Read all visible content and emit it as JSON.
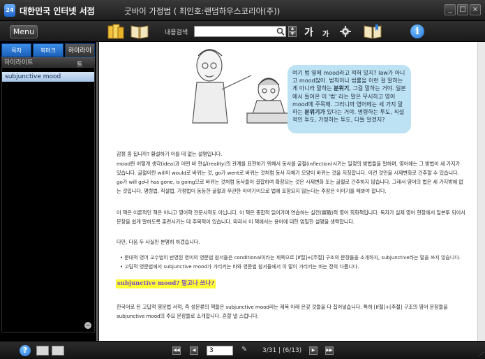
{
  "window": {
    "app_logo": "24",
    "app_name": "대한민국 인터넷 서점",
    "book_title": "굿바이 가정법 ( 최인호:랜덤하우스코리아(주))",
    "controls": [
      "_",
      "□",
      "×"
    ]
  },
  "toolbar": {
    "menu_label": "Menu",
    "search_label": "내용검색",
    "search_value": "",
    "font_larger": "가",
    "font_smaller": "가",
    "icons": [
      "books-icon",
      "open-book-icon",
      "settings-icon",
      "bookmark-book-icon",
      "info-icon"
    ]
  },
  "sidebar": {
    "tabs": [
      "목차",
      "북마크",
      "하이라이트"
    ],
    "active_tab": "하이라이트",
    "panel_title": "하이라이트",
    "items": [
      "subjunctive mood"
    ]
  },
  "content": {
    "bubble_parts": [
      {
        "t": "여기 법 옆에 mood라고 적혀 있지? law가 아니고 mood잖아. 법칙이나 법률을 이런 걸 말하는 게 아니라 말하는 "
      },
      {
        "t": "분위기",
        "b": true
      },
      {
        "t": ", 그걸 말하는 거야. 일본에서 들어온 이 '법' 라는 말은 무시하고 영어 mood에 주목해. 그러니까 영어에는 세 가지 말하는 "
      },
      {
        "t": "분위기가",
        "b": true
      },
      {
        "t": " 있다는 거야. 명령하는 투도, 직설적인 투도, 가정하는 투도, 다들 알겠지?"
      }
    ],
    "para1": "감정 좀 됩니까? 황설하기 이를 데 없는 설명입니다.",
    "para2": "mood란 어떻게 생각(idea)과 어떤 바 현실(reality)의 관계를 표현하기 위해서 동사를 굴절(inflection)시키는 일정의 방법들을 말하며, 영어에는 그 방법이 세 가지가 있습니다. 굴절이란 will이 would로 바뀌는 것, go가 went로 바뀌는 것처럼 동사 자체가 모양이 바뀌는 것을 지칭합니다. 이런 것만을 시제변화로 간주할 수 있습니다. go가 will go나 has gone, is going으로 바뀌는 것처럼 동사들이 결합하여 확장되는 것은 시제변화 또는 굴절로 간주하지 않습니다. 그래서 영어의 법은 세 가지밖에 없는 것입니다. 명령법, 직설법, 가정법이 동등한 굴절과 무관한 이야기이므로 법에 포함되지 않는다는 주장은 이야기를 해봐야 합니다.",
    "para3": "이 책은 이론적인 책은 아니고 영어학 전문서적도 아닙니다. 이 책은 종합적 읽어가며 연습하는 실전(實戰)적 영어 회화책입니다. 독자가 실제 영어 현장에서 일본투 되어서 문장을 쉽게 말하도록 훈련시키는 데 주목적이 있습니다. 따라서 이 책에서는 용어에 대한 엄밀한 설명을 생략합니다.",
    "para4": "다만, 다음 두 사실만 분명히 하겠습니다.",
    "notes": [
      "• 문대적 영어 교수법이 반영된 영미의 영문법 참서들은 conditional이라는 제목으로 [If절]+[주절] 구조의 문장들을 소개하지, subjunctive라는 말을 쓰지 않습니다.",
      "• 고답적 영문법에서 subjunctive mood가 가리키는 바와 영문법 참서들에서 이 말이 가리키는 바는 전혀 다릅니다."
    ],
    "heading": "subjunctive mood? 말고나 쓰나?",
    "para5": "한국어로 된 고답적 영문법 서적, 즉 성문류의 책들은 subjunctive mood라는 제목 아래 온갖 것들을 다 집어넣습니다. 특히 [If절]+[주절] 구조의 영어 문장들을 subjunctive mood의 주요 문장들로 소개합니다. 흔할 낼 스럽니다."
  },
  "footer": {
    "page_input": "3",
    "page_counter": "3/31 | (6/13)",
    "nav": [
      "◀◀",
      "◀",
      "▶",
      "▶▶"
    ],
    "help": "?",
    "grip": "⋰"
  },
  "colors": {
    "bubble": "#bde2f4",
    "heading_highlight": "#ffff33",
    "heading_text": "#7a48c8",
    "tab_blue": "#2f7fd8"
  }
}
